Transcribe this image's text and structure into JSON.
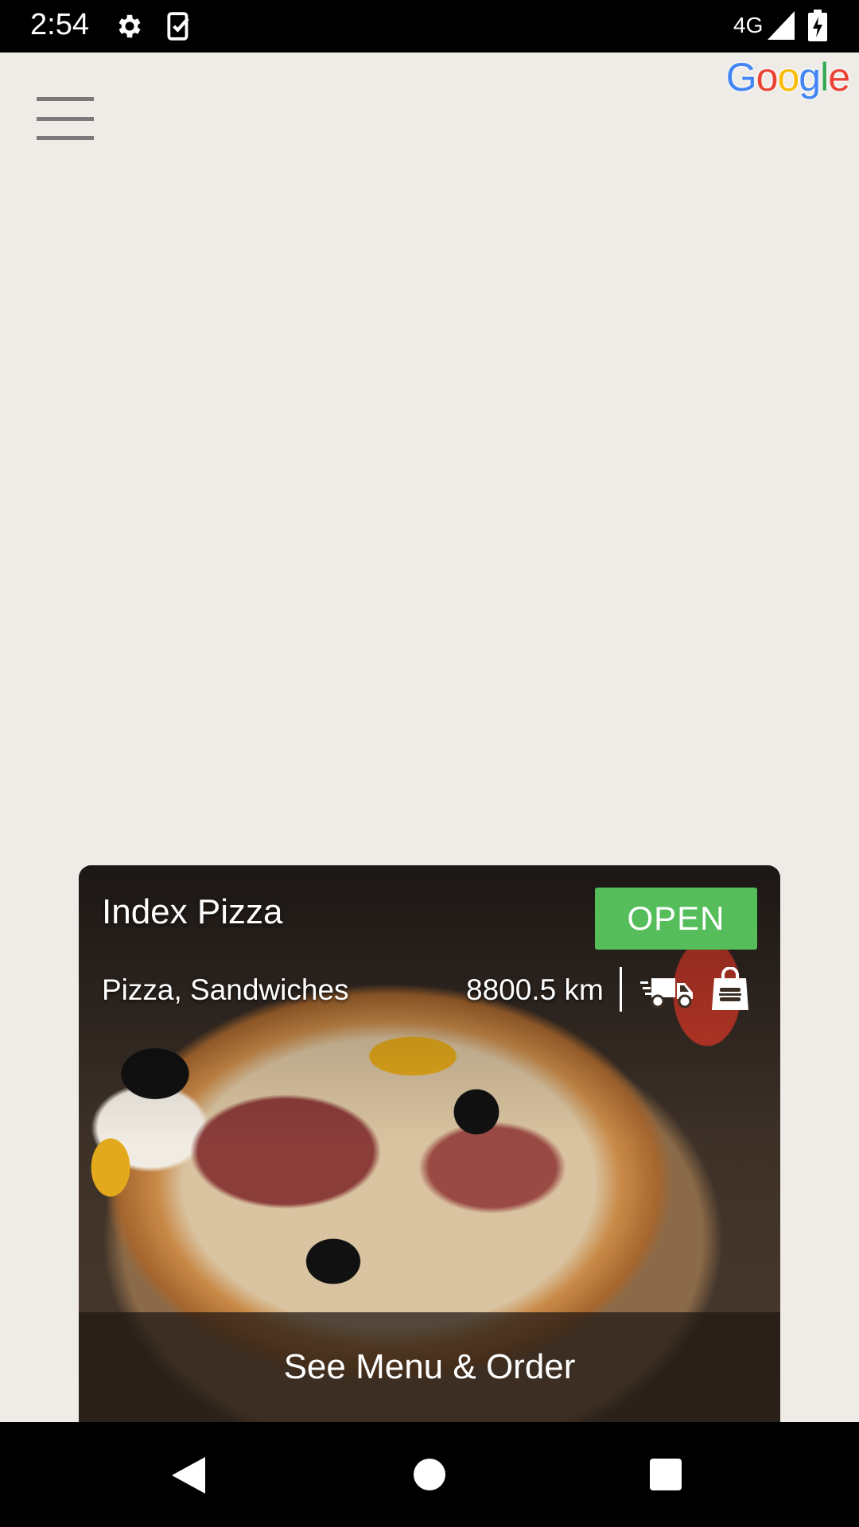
{
  "status_bar": {
    "time": "2:54",
    "network": "4G",
    "icons": [
      "settings-icon",
      "task-check-icon",
      "signal-icon",
      "battery-charging-icon"
    ]
  },
  "map": {
    "attribution": "Google",
    "menu_icon": "hamburger-menu-icon"
  },
  "restaurant_card": {
    "name": "Index Pizza",
    "status": "OPEN",
    "status_color": "#56bd5b",
    "cuisine": "Pizza, Sandwiches",
    "distance": "8800.5 km",
    "service_icons": [
      "delivery-truck-icon",
      "takeout-bag-icon"
    ],
    "action_label": "See Menu & Order"
  },
  "nav_bar": {
    "buttons": [
      "back",
      "home",
      "recents"
    ]
  }
}
